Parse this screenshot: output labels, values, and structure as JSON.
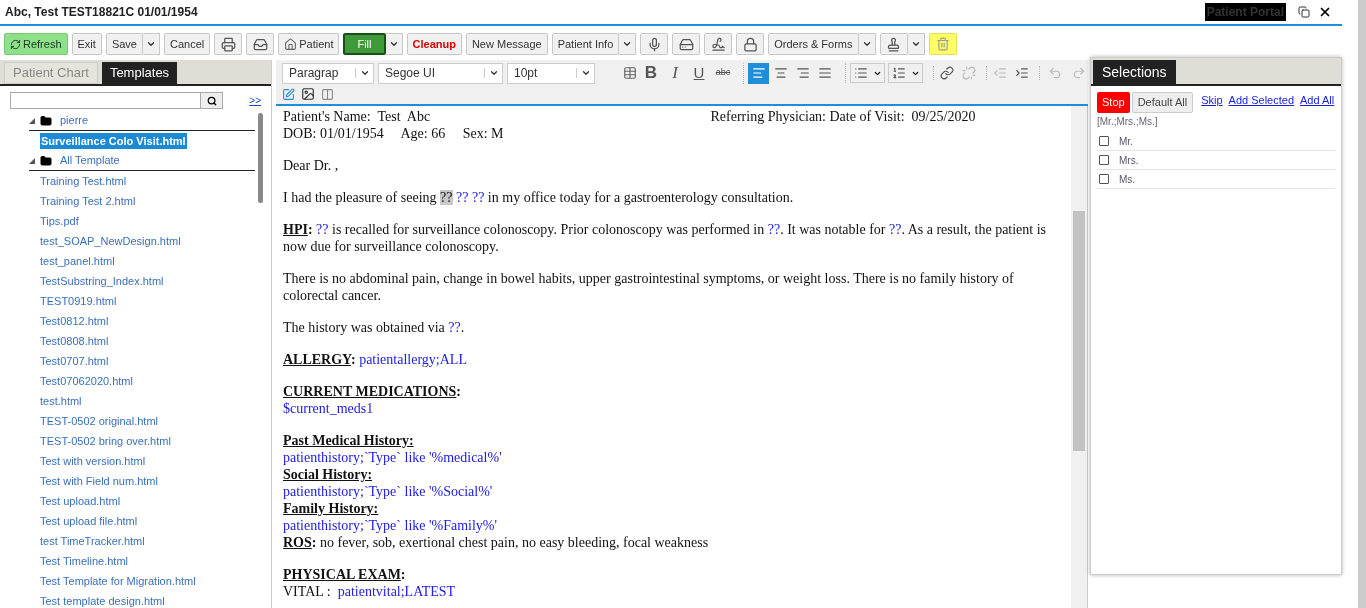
{
  "window": {
    "title": "Abc, Test TEST18821C 01/01/1954",
    "portal": "Patient Portal"
  },
  "toolbar": [
    {
      "kind": "refresh",
      "split": false,
      "label": "Refresh"
    },
    {
      "kind": "button",
      "split": false,
      "label": "Exit"
    },
    {
      "kind": "button",
      "split": true,
      "label": "Save"
    },
    {
      "kind": "button",
      "split": false,
      "label": "Cancel"
    },
    {
      "kind": "icon",
      "split": false
    },
    {
      "kind": "icon",
      "split": false
    },
    {
      "kind": "icon_text",
      "split": false,
      "label": "Patient"
    },
    {
      "kind": "fill",
      "split": true,
      "label": "Fill"
    },
    {
      "kind": "alert",
      "split": false,
      "label": "Cleanup"
    },
    {
      "kind": "button",
      "split": false,
      "label": "New Message"
    },
    {
      "kind": "button",
      "split": true,
      "label": "Patient Info"
    },
    {
      "kind": "icon",
      "split": false
    },
    {
      "kind": "icon",
      "split": false
    },
    {
      "kind": "icon",
      "split": false
    },
    {
      "kind": "icon",
      "split": false
    },
    {
      "kind": "button",
      "split": true,
      "label": "Orders & Forms"
    },
    {
      "kind": "icon",
      "split": true
    },
    {
      "kind": "trash",
      "split": false
    }
  ],
  "left_panel": {
    "tabs": [
      {
        "label": "Patient Chart",
        "selected": false
      },
      {
        "label": "Templates",
        "selected": true
      }
    ],
    "expand_link": ">>",
    "tree": [
      {
        "label": "pierre",
        "expanded": true,
        "children": [
          {
            "label": "Surveillance Colo Visit.html",
            "selected": true
          }
        ]
      },
      {
        "label": "All Template",
        "expanded": true,
        "children": [
          {
            "label": "Training Test.html",
            "selected": false
          },
          {
            "label": "Training Test 2.html",
            "selected": false
          },
          {
            "label": "Tips.pdf",
            "selected": false
          },
          {
            "label": "test_SOAP_NewDesign.html",
            "selected": false
          },
          {
            "label": "test_panel.html",
            "selected": false
          },
          {
            "label": "TestSubstring_Index.html",
            "selected": false
          },
          {
            "label": "TEST0919.html",
            "selected": false
          },
          {
            "label": "Test0812.html",
            "selected": false
          },
          {
            "label": "Test0808.html",
            "selected": false
          },
          {
            "label": "Test0707.html",
            "selected": false
          },
          {
            "label": "Test07062020.html",
            "selected": false
          },
          {
            "label": "test.html",
            "selected": false
          },
          {
            "label": "TEST-0502 original.html",
            "selected": false
          },
          {
            "label": "TEST-0502 bring over.html",
            "selected": false
          },
          {
            "label": "Test with version.html",
            "selected": false
          },
          {
            "label": "Test with Field num.html",
            "selected": false
          },
          {
            "label": "Test upload.html",
            "selected": false
          },
          {
            "label": "Test upload file.html",
            "selected": false
          },
          {
            "label": "test TimeTracker.html",
            "selected": false
          },
          {
            "label": "Test Timeline.html",
            "selected": false
          },
          {
            "label": "Test Template for Migration.html",
            "selected": false
          },
          {
            "label": "Test template design.html",
            "selected": false
          }
        ]
      }
    ]
  },
  "editor": {
    "block_format": "Paragrap",
    "font": "Segoe UI",
    "size": "10pt",
    "format_buttons": [
      {
        "label": "B"
      },
      {
        "label": "I"
      },
      {
        "label": "U"
      },
      {
        "label": "abc"
      }
    ],
    "alignments": [
      {
        "selected": true
      },
      {
        "selected": false
      },
      {
        "selected": false
      },
      {
        "selected": false
      }
    ],
    "document": {
      "header": {
        "lines": [
          [
            {
              "kind": "text",
              "text": "Patient's Name:  Test  Abc"
            }
          ],
          [
            {
              "kind": "text",
              "text": "DOB: 01/01/1954     Age: 66     Sex: M"
            }
          ]
        ],
        "aside": "Referring Physician: Date of Visit:  09/25/2020"
      },
      "blocks": [
        [
          [
            {
              "kind": "text",
              "text": "Dear Dr. ,"
            }
          ]
        ],
        [
          [
            {
              "kind": "text",
              "text": "I had the pleasure of seeing "
            },
            {
              "kind": "shaded",
              "text": "??"
            },
            {
              "kind": "field",
              "text": " ?? ??"
            },
            {
              "kind": "text",
              "text": " in my office today for a gastroenterology consultation."
            }
          ]
        ],
        [
          [
            {
              "kind": "label",
              "text": "HPI"
            },
            {
              "kind": "bold",
              "text": ": "
            },
            {
              "kind": "field",
              "text": "??"
            },
            {
              "kind": "text",
              "text": " is recalled for surveillance colonoscopy. Prior colonoscopy was performed in "
            },
            {
              "kind": "field",
              "text": "??"
            },
            {
              "kind": "text",
              "text": ". It was notable for "
            },
            {
              "kind": "field",
              "text": "??"
            },
            {
              "kind": "text",
              "text": ". As a result, the patient is now due for surveillance colonoscopy."
            }
          ]
        ],
        [
          [
            {
              "kind": "text",
              "text": "There is no abdominal pain, change in bowel habits, upper gastrointestinal symptoms, or weight loss. There is no family history of colorectal cancer."
            }
          ]
        ],
        [
          [
            {
              "kind": "text",
              "text": "The history was obtained via "
            },
            {
              "kind": "field",
              "text": "??"
            },
            {
              "kind": "text",
              "text": "."
            }
          ]
        ],
        [
          [
            {
              "kind": "label",
              "text": "ALLERGY"
            },
            {
              "kind": "bold",
              "text": ": "
            },
            {
              "kind": "field",
              "text": "patientallergy;ALL"
            }
          ]
        ],
        [
          [
            {
              "kind": "label",
              "text": "CURRENT MEDICATIONS"
            },
            {
              "kind": "bold",
              "text": ":"
            }
          ],
          [
            {
              "kind": "field",
              "text": "$current_meds1"
            }
          ]
        ],
        [
          [
            {
              "kind": "label",
              "text": "Past Medical History:"
            }
          ],
          [
            {
              "kind": "field",
              "text": "patienthistory;`Type` like '%medical%'"
            }
          ],
          [
            {
              "kind": "label",
              "text": "Social History:"
            }
          ],
          [
            {
              "kind": "field",
              "text": "patienthistory;`Type` like '%Social%'"
            }
          ],
          [
            {
              "kind": "label",
              "text": "Family History:"
            }
          ],
          [
            {
              "kind": "field",
              "text": "patienthistory;`Type` like '%Family%'"
            }
          ],
          [
            {
              "kind": "label",
              "text": "ROS"
            },
            {
              "kind": "bold",
              "text": ": "
            },
            {
              "kind": "text",
              "text": "no fever, sob, exertional chest pain, no easy bleeding, focal weakness"
            }
          ]
        ],
        [
          [
            {
              "kind": "label",
              "text": "PHYSICAL EXAM"
            },
            {
              "kind": "bold",
              "text": ":"
            }
          ],
          [
            {
              "kind": "text",
              "text": "VITAL :  "
            },
            {
              "kind": "field",
              "text": "patientvital;LATEST"
            }
          ]
        ]
      ]
    }
  },
  "selections": {
    "tab": "Selections",
    "stop": "Stop",
    "default_all": "Default All",
    "links": [
      "Skip",
      "Add Selected",
      "Add All"
    ],
    "group": "[Mr.;Mrs.;Ms.]",
    "options": [
      {
        "label": "Mr.",
        "checked": false
      },
      {
        "label": "Mrs.",
        "checked": false
      },
      {
        "label": "Ms.",
        "checked": false
      }
    ]
  }
}
